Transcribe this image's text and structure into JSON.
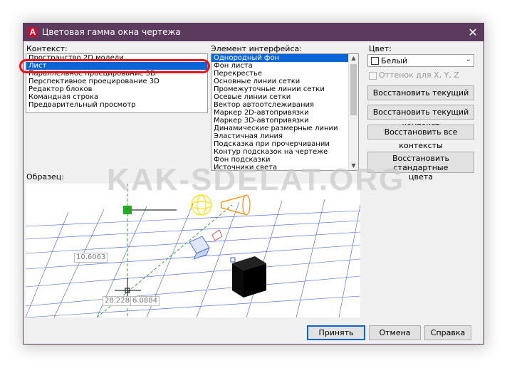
{
  "window": {
    "title": "Цветовая гамма окна чертежа",
    "app_logo": "A",
    "close_glyph": "✕"
  },
  "context": {
    "label": "Контекст:",
    "items": [
      "Пространство 2D модели",
      "Лист",
      "Параллельное проецирование 3D",
      "Перспективное проецирование 3D",
      "Редактор блоков",
      "Командная строка",
      "Предварительный просмотр"
    ],
    "selected": "Лист"
  },
  "interface_element": {
    "label": "Элемент интерфейса:",
    "items": [
      "Однородный фон",
      "Фон листа",
      "Перекрестье",
      "Основные линии сетки",
      "Промежуточные линии сетки",
      "Осевые линии сетки",
      "Вектор автоотслеживания",
      "Маркер 2D-автопривязки",
      "Маркер 3D-автопривязки",
      "Динамические размерные линии",
      "Эластичная линия",
      "Подсказка при прочерчивании",
      "Контур подсказок на чертеже",
      "Фон подсказки",
      "Источники света"
    ],
    "selected": "Однородный фон"
  },
  "color": {
    "label": "Цвет:",
    "value": "Белый",
    "tint_checkbox_label": "Оттенок для X, Y, Z"
  },
  "restore_buttons": {
    "current_element": "Восстановить текущий элемент",
    "current_context": "Восстановить текущий контекст",
    "all_contexts": "Восстановить все контексты",
    "standard_colors_line1": "Восстановить стандартные",
    "standard_colors_line2": "цвета"
  },
  "preview": {
    "label": "Образец:",
    "coord_left": "10.6063",
    "coord_x": "28.2280",
    "coord_y": "6.0884"
  },
  "footer": {
    "ok": "Принять",
    "cancel": "Отмена",
    "help": "Справка"
  },
  "watermark": "KAK-SDELAT.ORG",
  "colors": {
    "titlebar": "#5b3a5e",
    "selection": "#0a64d6",
    "highlight_oval": "#e8141c",
    "grid": "#3a5fd0",
    "crosshair_green": "#22aa22",
    "light_yellow": "#ffe000",
    "light_orange": "#ff8a00"
  }
}
